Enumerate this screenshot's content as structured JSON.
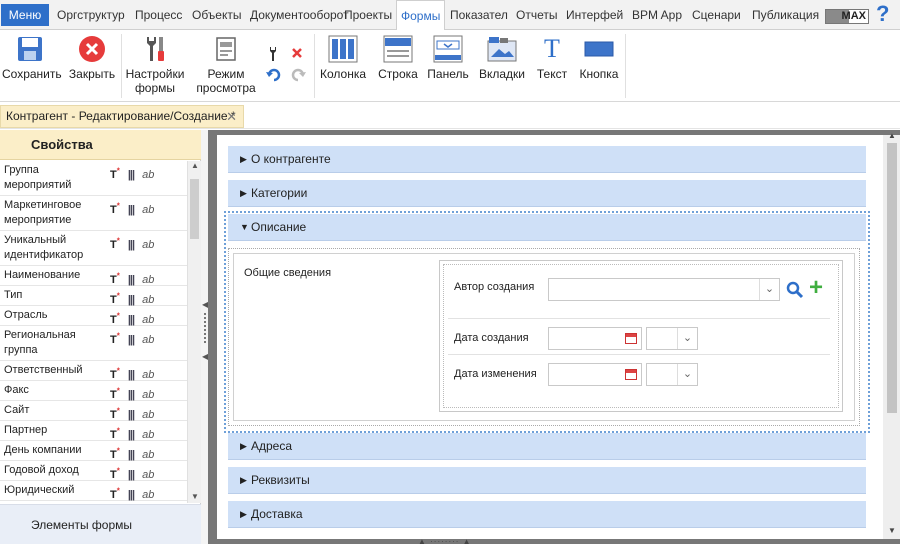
{
  "menubar": {
    "menu_label": "Меню",
    "items": [
      "Оргструктур",
      "Процесс",
      "Объекты",
      "Документооборот",
      "Проекты",
      "Формы",
      "Показател",
      "Отчеты",
      "Интерфей",
      "BPM App",
      "Сценари",
      "Публикация"
    ],
    "active_index": 5,
    "max_label": "MAX",
    "max_level_fraction": 0.55,
    "help_glyph": "?"
  },
  "ribbon": {
    "save": "Сохранить",
    "close": "Закрыть",
    "form_settings_line1": "Настройки",
    "form_settings_line2": "формы",
    "preview_line1": "Режим",
    "preview_line2": "просмотра",
    "column": "Колонка",
    "row": "Строка",
    "panel": "Панель",
    "tabs": "Вкладки",
    "text": "Текст",
    "text_glyph": "T",
    "button": "Кнопка"
  },
  "doc_tab": {
    "title": "Контрагент - Редактирование/Создание *",
    "close_glyph": "✕"
  },
  "properties": {
    "header": "Свойства",
    "rows": [
      {
        "name": "Группа мероприятий",
        "height": 2
      },
      {
        "name": "Маркетинговое мероприятие",
        "height": 2
      },
      {
        "name": "Уникальный идентификатор",
        "height": 2
      },
      {
        "name": "Наименование",
        "height": 1
      },
      {
        "name": "Тип",
        "height": 1
      },
      {
        "name": "Отрасль",
        "height": 1
      },
      {
        "name": "Региональная группа",
        "height": 2
      },
      {
        "name": "Ответственный",
        "height": 1
      },
      {
        "name": "Факс",
        "height": 1
      },
      {
        "name": "Сайт",
        "height": 1
      },
      {
        "name": "Партнер",
        "height": 1
      },
      {
        "name": "День компании",
        "height": 1
      },
      {
        "name": "Годовой доход",
        "height": 1
      },
      {
        "name": "Юридический",
        "height": 1
      }
    ],
    "icon_t": "T",
    "icon_star": "*",
    "icon_col": "|||",
    "icon_ab": "ab",
    "footer": "Элементы формы"
  },
  "form": {
    "sections": [
      {
        "label": "О контрагенте",
        "expanded": false
      },
      {
        "label": "Категории",
        "expanded": false
      },
      {
        "label": "Описание",
        "expanded": true
      },
      {
        "label": "Адреса",
        "expanded": false
      },
      {
        "label": "Реквизиты",
        "expanded": false
      },
      {
        "label": "Доставка",
        "expanded": false
      }
    ],
    "group_title": "Общие сведения",
    "fields": {
      "author": "Автор создания",
      "created": "Дата создания",
      "modified": "Дата изменения"
    },
    "chevron_glyph": "⌄",
    "plus_glyph": "+"
  }
}
